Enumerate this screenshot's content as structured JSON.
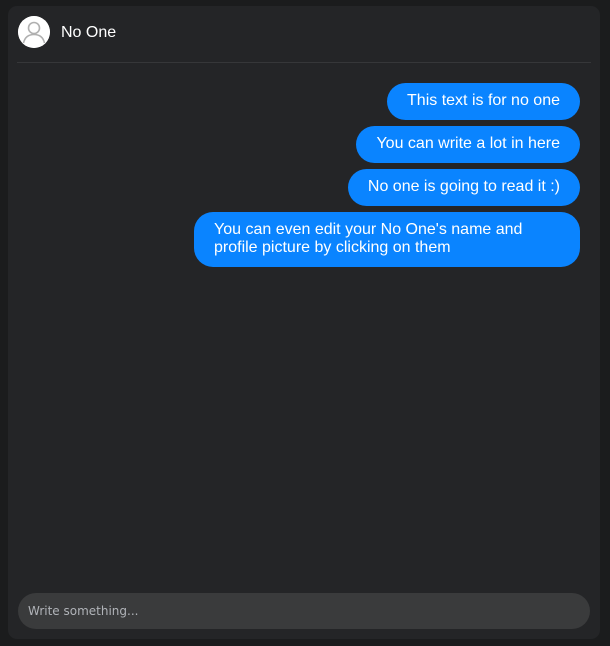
{
  "header": {
    "contact_name": "No One",
    "avatar_icon": "user-silhouette-icon"
  },
  "messages": [
    {
      "text": "This text is for no one"
    },
    {
      "text": "You can write a lot in here"
    },
    {
      "text": "No one is going to read it :)"
    },
    {
      "text": "You can even edit your No One's name and profile picture by clicking on them"
    }
  ],
  "composer": {
    "placeholder": "Write something...",
    "value": ""
  },
  "colors": {
    "bubble": "#0a84ff",
    "panel": "#242527",
    "background": "#1b1c1d",
    "input": "#3a3b3c"
  }
}
